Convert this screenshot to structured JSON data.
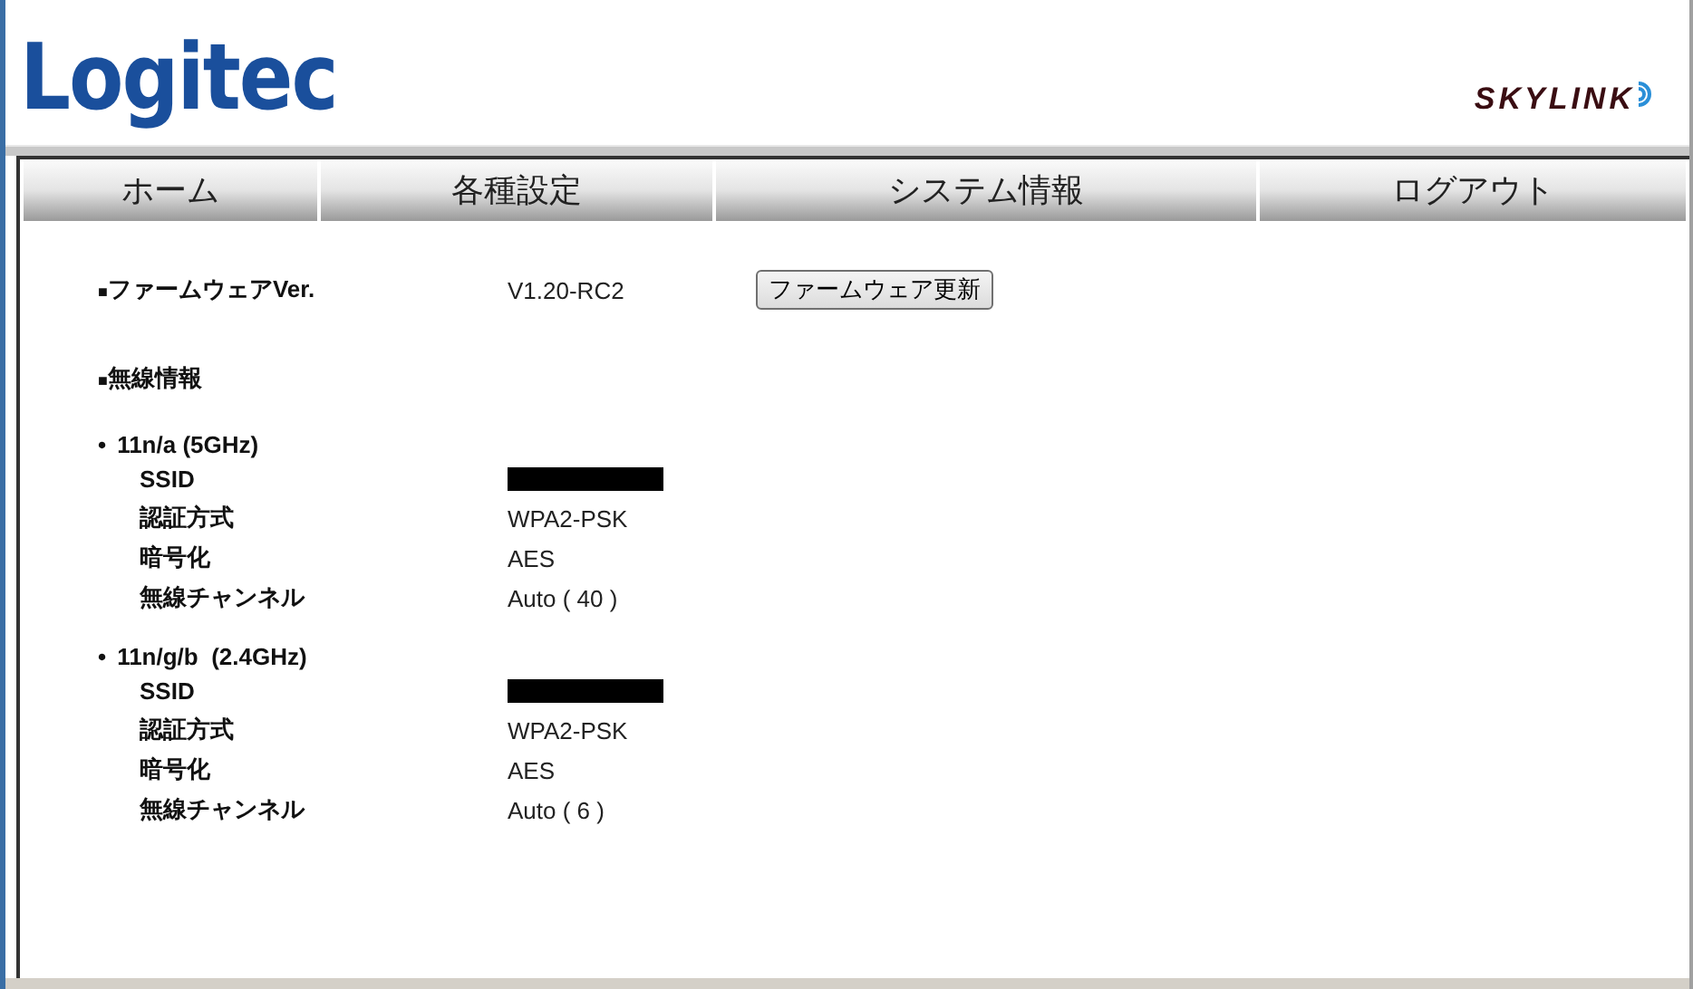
{
  "header": {
    "logo": "Logitec",
    "product_logo": "SKYLINK"
  },
  "nav": [
    {
      "label": "ホーム"
    },
    {
      "label": "各種設定"
    },
    {
      "label": "システム情報"
    },
    {
      "label": "ログアウト"
    }
  ],
  "firmware": {
    "marker": "■",
    "label": "ファームウェアVer.",
    "value": "V1.20-RC2",
    "button": "ファームウェア更新"
  },
  "wireless": {
    "marker": "■",
    "title": "無線情報",
    "bands": [
      {
        "bullet": "•",
        "name": "11n/a (5GHz)",
        "rows": [
          {
            "kind": "redacted",
            "label": "SSID"
          },
          {
            "kind": "text",
            "label": "認証方式",
            "value": "WPA2-PSK"
          },
          {
            "kind": "text",
            "label": "暗号化",
            "value": "AES"
          },
          {
            "kind": "text",
            "label": "無線チャンネル",
            "value": "Auto ( 40 )"
          }
        ]
      },
      {
        "bullet": "•",
        "name": "11n/g/b  (2.4GHz)",
        "rows": [
          {
            "kind": "redacted",
            "label": "SSID"
          },
          {
            "kind": "text",
            "label": "認証方式",
            "value": "WPA2-PSK"
          },
          {
            "kind": "text",
            "label": "暗号化",
            "value": "AES"
          },
          {
            "kind": "text",
            "label": "無線チャンネル",
            "value": "Auto ( 6 )"
          }
        ]
      }
    ]
  }
}
